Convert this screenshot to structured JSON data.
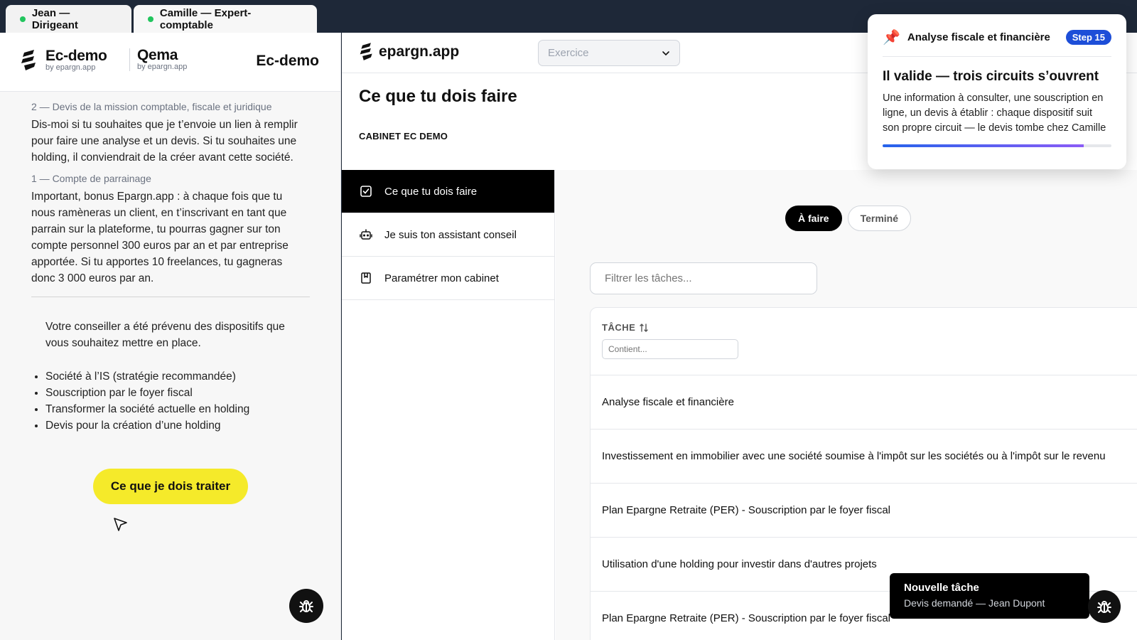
{
  "tabs": [
    {
      "label": "Jean — Dirigeant"
    },
    {
      "label": "Camille — Expert-comptable"
    }
  ],
  "left": {
    "brand1": {
      "name": "Ec-demo",
      "sub": "by epargn.app"
    },
    "brand2": {
      "name": "Qema",
      "sub": "by epargn.app"
    },
    "title": "Ec-demo",
    "sections": [
      {
        "title": "2 — Devis de la mission comptable, fiscale et juridique",
        "text": "Dis-moi si tu souhaites que je t’envoie un lien à remplir pour faire une analyse et un devis. Si tu souhaites une holding, il conviendrait de la créer avant cette société."
      },
      {
        "title": "1 — Compte de parrainage",
        "text": "Important, bonus Epargn.app : à chaque fois que tu nous ramèneras un client, en t’inscrivant en tant que parrain sur la plateforme, tu pourras gagner sur ton compte personnel 300 euros par an et par entreprise apportée. Si tu apportes 10 freelances, tu gagneras donc 3 000 euros par an."
      }
    ],
    "notice": "Votre conseiller a été prévenu des dispositifs que vous souhaitez mettre en place.",
    "bullets": [
      "Société à l’IS (stratégie recommandée)",
      "Souscription par le foyer fiscal",
      "Transformer la société actuelle en holding",
      "Devis pour la création d’une holding"
    ],
    "cta": "Ce que je dois traiter"
  },
  "app": {
    "logo": "epargn.app",
    "exercice_placeholder": "Exercice",
    "page_title": "Ce que tu dois faire",
    "cabinet": "CABINET EC DEMO",
    "nav": [
      {
        "label": "Ce que tu dois faire",
        "icon": "checkbox-icon",
        "active": true
      },
      {
        "label": "Je suis ton assistant conseil",
        "icon": "robot-icon",
        "active": false
      },
      {
        "label": "Paramétrer mon cabinet",
        "icon": "bookmark-icon",
        "active": false
      }
    ],
    "toggle": {
      "todo": "À faire",
      "done": "Terminé"
    },
    "filter_placeholder": "Filtrer les tâches...",
    "table": {
      "header": "TÂCHE",
      "column_filter_placeholder": "Contient...",
      "rows": [
        "Analyse fiscale et financière",
        "Investissement en immobilier avec une société soumise à l'impôt sur les sociétés ou à l'impôt sur le revenu",
        "Plan Epargne Retraite (PER) - Souscription par le foyer fiscal",
        "Utilisation d'une holding pour investir dans d'autres projets",
        "Plan Epargne Retraite (PER) - Souscription par le foyer fiscal"
      ]
    }
  },
  "step": {
    "label": "Analyse fiscale et financière",
    "badge": "Step 15",
    "title": "Il valide — trois circuits s’ouvrent",
    "text": "Une information à consulter, une souscription en ligne, un devis à établir : chaque dispositif suit son propre circuit — le devis tombe chez Camille",
    "progress": 0.88
  },
  "toast": {
    "title": "Nouvelle tâche",
    "text": "Devis demandé — Jean Dupont"
  },
  "colors": {
    "cta": "#f5ea2a",
    "badge": "#1d4ed8",
    "online_dot": "#22c55e",
    "topbar": "#1e2838"
  }
}
